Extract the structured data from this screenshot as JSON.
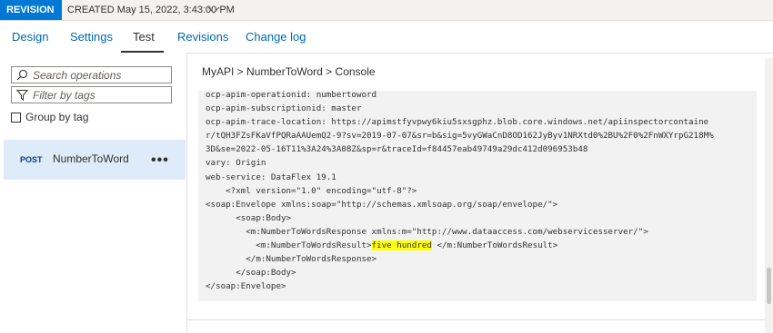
{
  "revision_bar": {
    "badge": "REVISION 1",
    "created": "CREATED May 15, 2022, 3:43:00 PM",
    "chevron_icon": "chevron-down-icon"
  },
  "tabs": [
    {
      "label": "Design"
    },
    {
      "label": "Settings"
    },
    {
      "label": "Test"
    },
    {
      "label": "Revisions"
    },
    {
      "label": "Change log"
    }
  ],
  "active_tab": "Test",
  "left_panel": {
    "search_placeholder": "Search operations",
    "filter_placeholder": "Filter by tags",
    "group_by_label": "Group by tag",
    "operations": [
      {
        "method": "POST",
        "name": "NumberToWord",
        "more": "•••"
      }
    ]
  },
  "breadcrumb": {
    "api": "MyAPI",
    "sep1": " > ",
    "operation": "NumberToWord",
    "sep2": " > ",
    "page": "Console"
  },
  "console": {
    "lines": [
      "ocp-apim-operationid: numbertoword",
      "ocp-apim-subscriptionid: master",
      "ocp-apim-trace-location: https://apimstfyvpwy6kiu5sxsgphz.blob.core.windows.net/apiinspectorcontaine",
      "r/tQH3FZsFKaVfPQRaAAUemQ2-9?sv=2019-07-07&sr=b&sig=5vyGWaCnD8OD162JyByv1NRXtd0%2BU%2F0%2FnWXYrpG218M%",
      "3D&se=2022-05-16T11%3A24%3A08Z&sp=r&traceId=f84457eab49749a29dc412d096953b48",
      "vary: Origin",
      "web-service: DataFlex 19.1",
      "    <?xml version=\"1.0\" encoding=\"utf-8\"?>",
      "<soap:Envelope xmlns:soap=\"http://schemas.xmlsoap.org/soap/envelope/\">",
      "      <soap:Body>",
      "        <m:NumberToWordsResponse xmlns:m=\"http://www.dataaccess.com/webservicesserver/\">",
      "          <m:NumberToWordsResult>",
      "five hundred",
      " </m:NumberToWordsResult>",
      "        </m:NumberToWordsResponse>",
      "      </soap:Body>",
      "</soap:Envelope>"
    ]
  }
}
